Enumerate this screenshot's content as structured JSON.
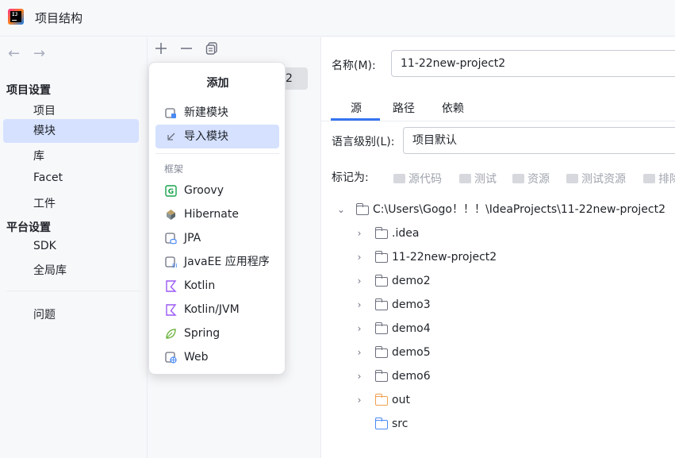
{
  "window": {
    "title": "项目结构"
  },
  "nav": {
    "back": "←",
    "forward": "→"
  },
  "sidebar": {
    "project_settings": "项目设置",
    "items_project": [
      "项目",
      "模块",
      "库",
      "Facet",
      "工件"
    ],
    "platform_settings": "平台设置",
    "items_platform": [
      "SDK",
      "全局库"
    ],
    "problems": "问题"
  },
  "middle": {
    "selected_module_suffix": "2"
  },
  "popup": {
    "title": "添加",
    "actions": [
      {
        "label": "新建模块",
        "icon": "new-module-icon"
      },
      {
        "label": "导入模块",
        "icon": "import-module-icon"
      }
    ],
    "group_label": "框架",
    "frameworks": [
      {
        "label": "Groovy",
        "icon": "groovy-icon",
        "color": "#16a34a"
      },
      {
        "label": "Hibernate",
        "icon": "hibernate-icon",
        "color": "#59666c"
      },
      {
        "label": "JPA",
        "icon": "jpa-icon",
        "color": "#4a8af4"
      },
      {
        "label": "JavaEE 应用程序",
        "icon": "javaee-icon",
        "color": "#4a8af4"
      },
      {
        "label": "Kotlin",
        "icon": "kotlin-icon",
        "color": "#9a59f5"
      },
      {
        "label": "Kotlin/JVM",
        "icon": "kotlin-icon",
        "color": "#9a59f5"
      },
      {
        "label": "Spring",
        "icon": "spring-icon",
        "color": "#6db33f"
      },
      {
        "label": "Web",
        "icon": "web-icon",
        "color": "#4a8af4"
      }
    ]
  },
  "detail": {
    "name_label": "名称(M):",
    "name_value": "11-22new-project2",
    "tabs": [
      "源",
      "路径",
      "依赖"
    ],
    "language_level_label": "语言级别(L):",
    "language_level_value": "项目默认",
    "mark_as_label": "标记为:",
    "mark_as_options": [
      "源代码",
      "测试",
      "资源",
      "测试资源",
      "排除"
    ],
    "tree": [
      {
        "label": "C:\\Users\\Gogo！！！\\IdeaProjects\\11-22new-project2",
        "expanded": true,
        "color": "gray"
      },
      {
        "label": ".idea",
        "color": "gray"
      },
      {
        "label": "11-22new-project2",
        "color": "gray"
      },
      {
        "label": "demo2",
        "color": "gray"
      },
      {
        "label": "demo3",
        "color": "gray"
      },
      {
        "label": "demo4",
        "color": "gray"
      },
      {
        "label": "demo5",
        "color": "gray"
      },
      {
        "label": "demo6",
        "color": "gray"
      },
      {
        "label": "out",
        "color": "orange"
      },
      {
        "label": "src",
        "color": "blue"
      }
    ]
  },
  "colors": {
    "accent": "#3574f0",
    "selection": "#d5e1ff"
  }
}
